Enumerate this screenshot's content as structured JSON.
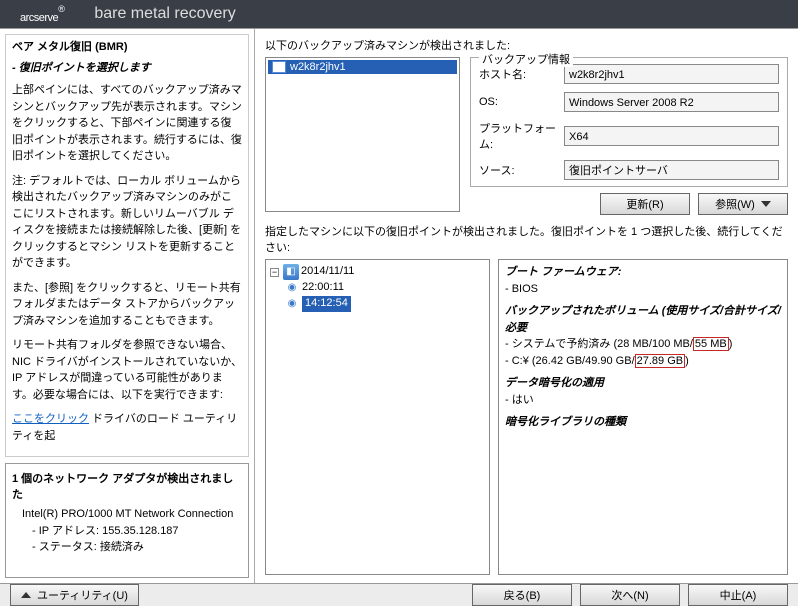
{
  "header": {
    "logo": "arcserve",
    "reg": "®",
    "subtitle": "bare metal recovery"
  },
  "left": {
    "title": "ベア メタル復旧 (BMR)",
    "sub": "- 復旧ポイントを選択します",
    "p1": "上部ペインには、すべてのバックアップ済みマシンとバックアップ先が表示されます。マシンをクリックすると、下部ペインに関連する復旧ポイントが表示されます。続行するには、復旧ポイントを選択してください。",
    "p2": "注: デフォルトでは、ローカル ボリュームから検出されたバックアップ済みマシンのみがここにリストされます。新しいリムーバブル ディスクを接続または接続解除した後、[更新] をクリックするとマシン リストを更新することができます。",
    "p3": "また、[参照] をクリックすると、リモート共有フォルダまたはデータ ストアからバックアップ済みマシンを追加することもできます。",
    "p4": "リモート共有フォルダを参照できない場合、NIC ドライバがインストールされていないか、IP アドレスが間違っている可能性があります。必要な場合には、以下を実行できます:",
    "link": "ここをクリック",
    "link_after": "  ドライバのロード ユーティリティを起",
    "net_title": "1 個のネットワーク アダプタが検出されました",
    "net_adapter": "Intel(R) PRO/1000 MT Network Connection",
    "net_ip": "- IP アドレス: 155.35.128.187",
    "net_status": "- ステータス: 接続済み"
  },
  "right": {
    "detected": "以下のバックアップ済みマシンが検出されました:",
    "machine": "w2k8r2jhv1",
    "info_title": "バックアップ情報",
    "host_lbl": "ホスト名:",
    "host_val": "w2k8r2jhv1",
    "os_lbl": "OS:",
    "os_val": "Windows Server 2008 R2",
    "plat_lbl": "プラットフォーム:",
    "plat_val": "X64",
    "src_lbl": "ソース:",
    "src_val": "復旧ポイントサーバ",
    "refresh_btn": "更新(R)",
    "browse_btn": "参照(W)",
    "lower_label": "指定したマシンに以下の復旧ポイントが検出されました。復旧ポイントを 1 つ選択した後、続行してください:",
    "tree": {
      "date": "2014/11/11",
      "t1": "22:00:11",
      "t2": "14:12:54"
    },
    "details": {
      "fw_title": "ブート ファームウェア:",
      "fw_val": "- BIOS",
      "vol_title": "バックアップされたボリューム (使用サイズ/合計サイズ/必要",
      "vol1a": "- システムで予約済み (28 MB/100 MB/",
      "vol1b": "55 MB",
      "vol1c": ")",
      "vol2a": "- C:¥ (26.42 GB/49.90 GB/",
      "vol2b": "27.89 GB",
      "vol2c": ")",
      "enc_title": "データ暗号化の適用",
      "enc_val": "- はい",
      "lib_title": "暗号化ライブラリの種類"
    }
  },
  "footer": {
    "utility": "ユーティリティ(U)",
    "back": "戻る(B)",
    "next": "次へ(N)",
    "abort": "中止(A)"
  }
}
